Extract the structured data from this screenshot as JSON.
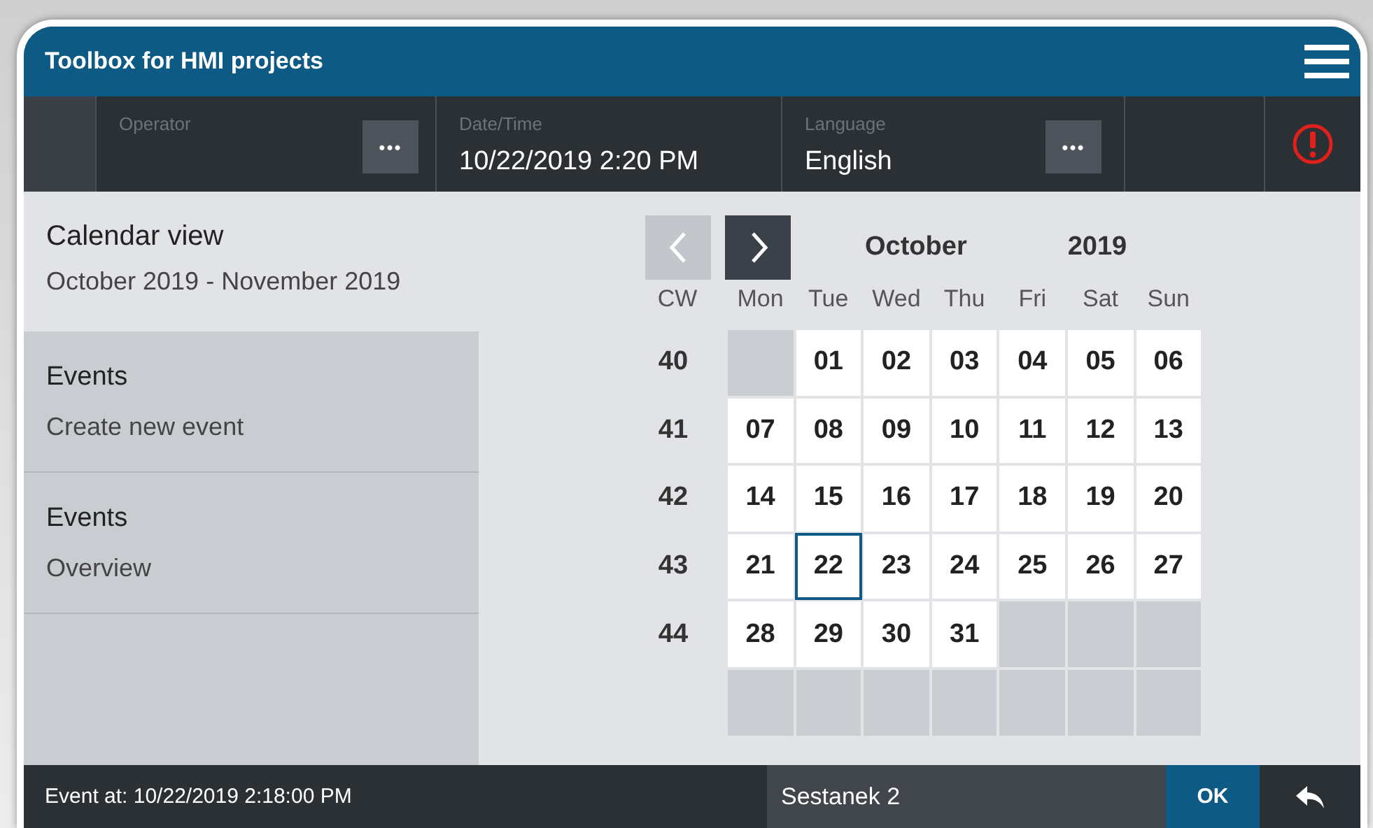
{
  "window": {
    "title": "Toolbox for HMI projects"
  },
  "toolbar": {
    "fields": [
      {
        "label": "Operator",
        "button": "•••"
      },
      {
        "label": "Date/Time",
        "value": "10/22/2019 2:20 PM"
      },
      {
        "label": "Language",
        "value": "English",
        "button": "•••"
      }
    ],
    "alarm": true
  },
  "sidebar": {
    "title": "Calendar view",
    "subtitle": "October 2019 - November 2019",
    "items": [
      {
        "title": "Events",
        "subtitle": "Create new event"
      },
      {
        "title": "Events",
        "subtitle": "Overview"
      }
    ]
  },
  "calendar": {
    "prev": {
      "disabled": true
    },
    "next": {
      "disabled": false
    },
    "month": "October",
    "year": "2019",
    "cw_header": "CW",
    "weekdays": [
      "Mon",
      "Tue",
      "Wed",
      "Thu",
      "Fri",
      "Sat",
      "Sun"
    ],
    "weeks": [
      {
        "cw": "40",
        "days": [
          {
            "kind": "blank"
          },
          {
            "kind": "day",
            "label": "01",
            "selected": false
          },
          {
            "kind": "day",
            "label": "02",
            "selected": false
          },
          {
            "kind": "day",
            "label": "03",
            "selected": false
          },
          {
            "kind": "day",
            "label": "04",
            "selected": false
          },
          {
            "kind": "day",
            "label": "05",
            "selected": false
          },
          {
            "kind": "day",
            "label": "06",
            "selected": false
          }
        ]
      },
      {
        "cw": "41",
        "days": [
          {
            "kind": "day",
            "label": "07",
            "selected": false
          },
          {
            "kind": "day",
            "label": "08",
            "selected": false
          },
          {
            "kind": "day",
            "label": "09",
            "selected": false
          },
          {
            "kind": "day",
            "label": "10",
            "selected": false
          },
          {
            "kind": "day",
            "label": "11",
            "selected": false
          },
          {
            "kind": "day",
            "label": "12",
            "selected": false
          },
          {
            "kind": "day",
            "label": "13",
            "selected": false
          }
        ]
      },
      {
        "cw": "42",
        "days": [
          {
            "kind": "day",
            "label": "14",
            "selected": false
          },
          {
            "kind": "day",
            "label": "15",
            "selected": false
          },
          {
            "kind": "day",
            "label": "16",
            "selected": false
          },
          {
            "kind": "day",
            "label": "17",
            "selected": false
          },
          {
            "kind": "day",
            "label": "18",
            "selected": false
          },
          {
            "kind": "day",
            "label": "19",
            "selected": false
          },
          {
            "kind": "day",
            "label": "20",
            "selected": false
          }
        ]
      },
      {
        "cw": "43",
        "days": [
          {
            "kind": "day",
            "label": "21",
            "selected": false
          },
          {
            "kind": "day",
            "label": "22",
            "selected": true
          },
          {
            "kind": "day",
            "label": "23",
            "selected": false
          },
          {
            "kind": "day",
            "label": "24",
            "selected": false
          },
          {
            "kind": "day",
            "label": "25",
            "selected": false
          },
          {
            "kind": "day",
            "label": "26",
            "selected": false
          },
          {
            "kind": "day",
            "label": "27",
            "selected": false
          }
        ]
      },
      {
        "cw": "44",
        "days": [
          {
            "kind": "day",
            "label": "28",
            "selected": false
          },
          {
            "kind": "day",
            "label": "29",
            "selected": false
          },
          {
            "kind": "day",
            "label": "30",
            "selected": false
          },
          {
            "kind": "day",
            "label": "31",
            "selected": false
          },
          {
            "kind": "blank"
          },
          {
            "kind": "blank"
          },
          {
            "kind": "blank"
          }
        ]
      },
      {
        "days": [
          {
            "kind": "blank"
          },
          {
            "kind": "blank"
          },
          {
            "kind": "blank"
          },
          {
            "kind": "blank"
          },
          {
            "kind": "blank"
          },
          {
            "kind": "blank"
          },
          {
            "kind": "blank"
          }
        ]
      }
    ]
  },
  "footer": {
    "event": "Event at: 10/22/2019 2:18:00 PM",
    "name": "Sestanek 2",
    "ok": "OK"
  }
}
